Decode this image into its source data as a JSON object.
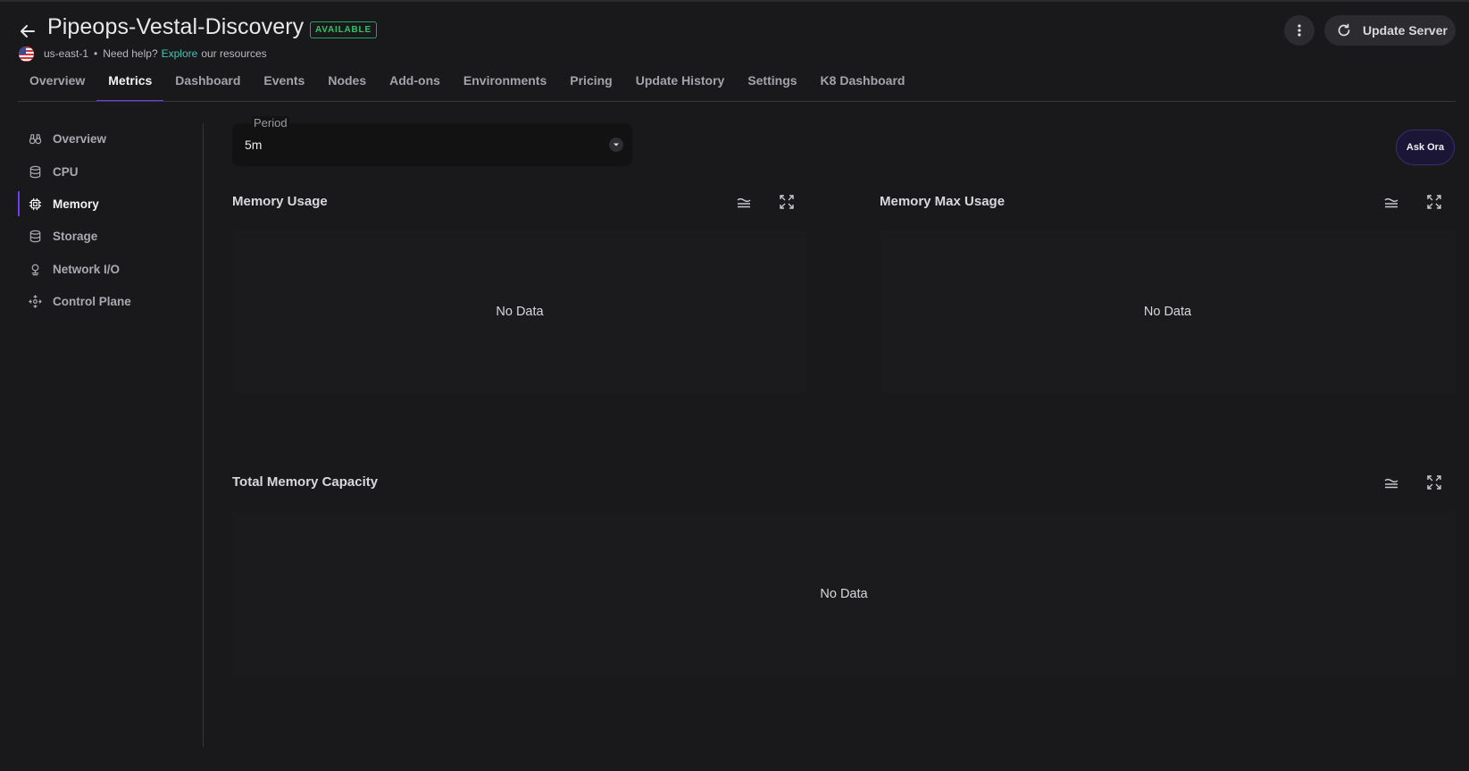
{
  "header": {
    "title": "Pipeops-Vestal-Discovery",
    "status": "AVAILABLE",
    "region": "us-east-1",
    "help_prefix": "Need help?",
    "help_link": "Explore",
    "help_suffix": "our resources",
    "update_label": "Update Server"
  },
  "tabs": [
    {
      "label": "Overview"
    },
    {
      "label": "Metrics",
      "active": true
    },
    {
      "label": "Dashboard"
    },
    {
      "label": "Events"
    },
    {
      "label": "Nodes"
    },
    {
      "label": "Add-ons"
    },
    {
      "label": "Environments"
    },
    {
      "label": "Pricing"
    },
    {
      "label": "Update History"
    },
    {
      "label": "Settings"
    },
    {
      "label": "K8 Dashboard"
    }
  ],
  "sidebar": {
    "items": [
      {
        "label": "Overview",
        "icon": "binoculars-icon"
      },
      {
        "label": "CPU",
        "icon": "database-icon"
      },
      {
        "label": "Memory",
        "icon": "chip-icon",
        "active": true
      },
      {
        "label": "Storage",
        "icon": "database-icon"
      },
      {
        "label": "Network I/O",
        "icon": "network-icon"
      },
      {
        "label": "Control Plane",
        "icon": "control-plane-icon"
      }
    ]
  },
  "period": {
    "label": "Period",
    "value": "5m"
  },
  "ask_ora": "Ask Ora",
  "panels": [
    {
      "title": "Memory Usage",
      "empty": "No Data"
    },
    {
      "title": "Memory Max Usage",
      "empty": "No Data"
    },
    {
      "title": "Total Memory Capacity",
      "empty": "No Data"
    }
  ],
  "colors": {
    "accent": "#6d3df0",
    "status_green": "#32c06b",
    "link": "#3ec5b7",
    "background": "#19191b"
  }
}
